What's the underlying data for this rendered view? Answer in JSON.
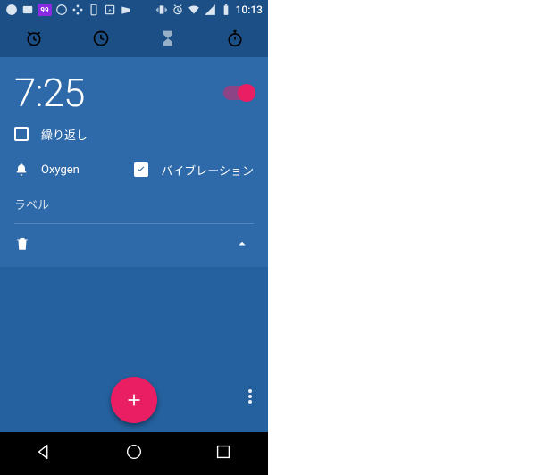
{
  "status": {
    "badge": "99",
    "time": "10:13"
  },
  "tabs": {
    "alarm": "alarm",
    "clock": "clock",
    "timer": "timer",
    "stopwatch": "stopwatch"
  },
  "alarm": {
    "time": "7:25",
    "enabled": true,
    "repeat_label": "繰り返し",
    "repeat_checked": false,
    "ringtone": "Oxygen",
    "vibrate_label": "バイブレーション",
    "vibrate_checked": true,
    "label_placeholder": "ラベル"
  },
  "colors": {
    "accent": "#e91e63",
    "tab_bar": "#1b4f86",
    "card": "#2e6aa9",
    "bg": "#25619e"
  }
}
